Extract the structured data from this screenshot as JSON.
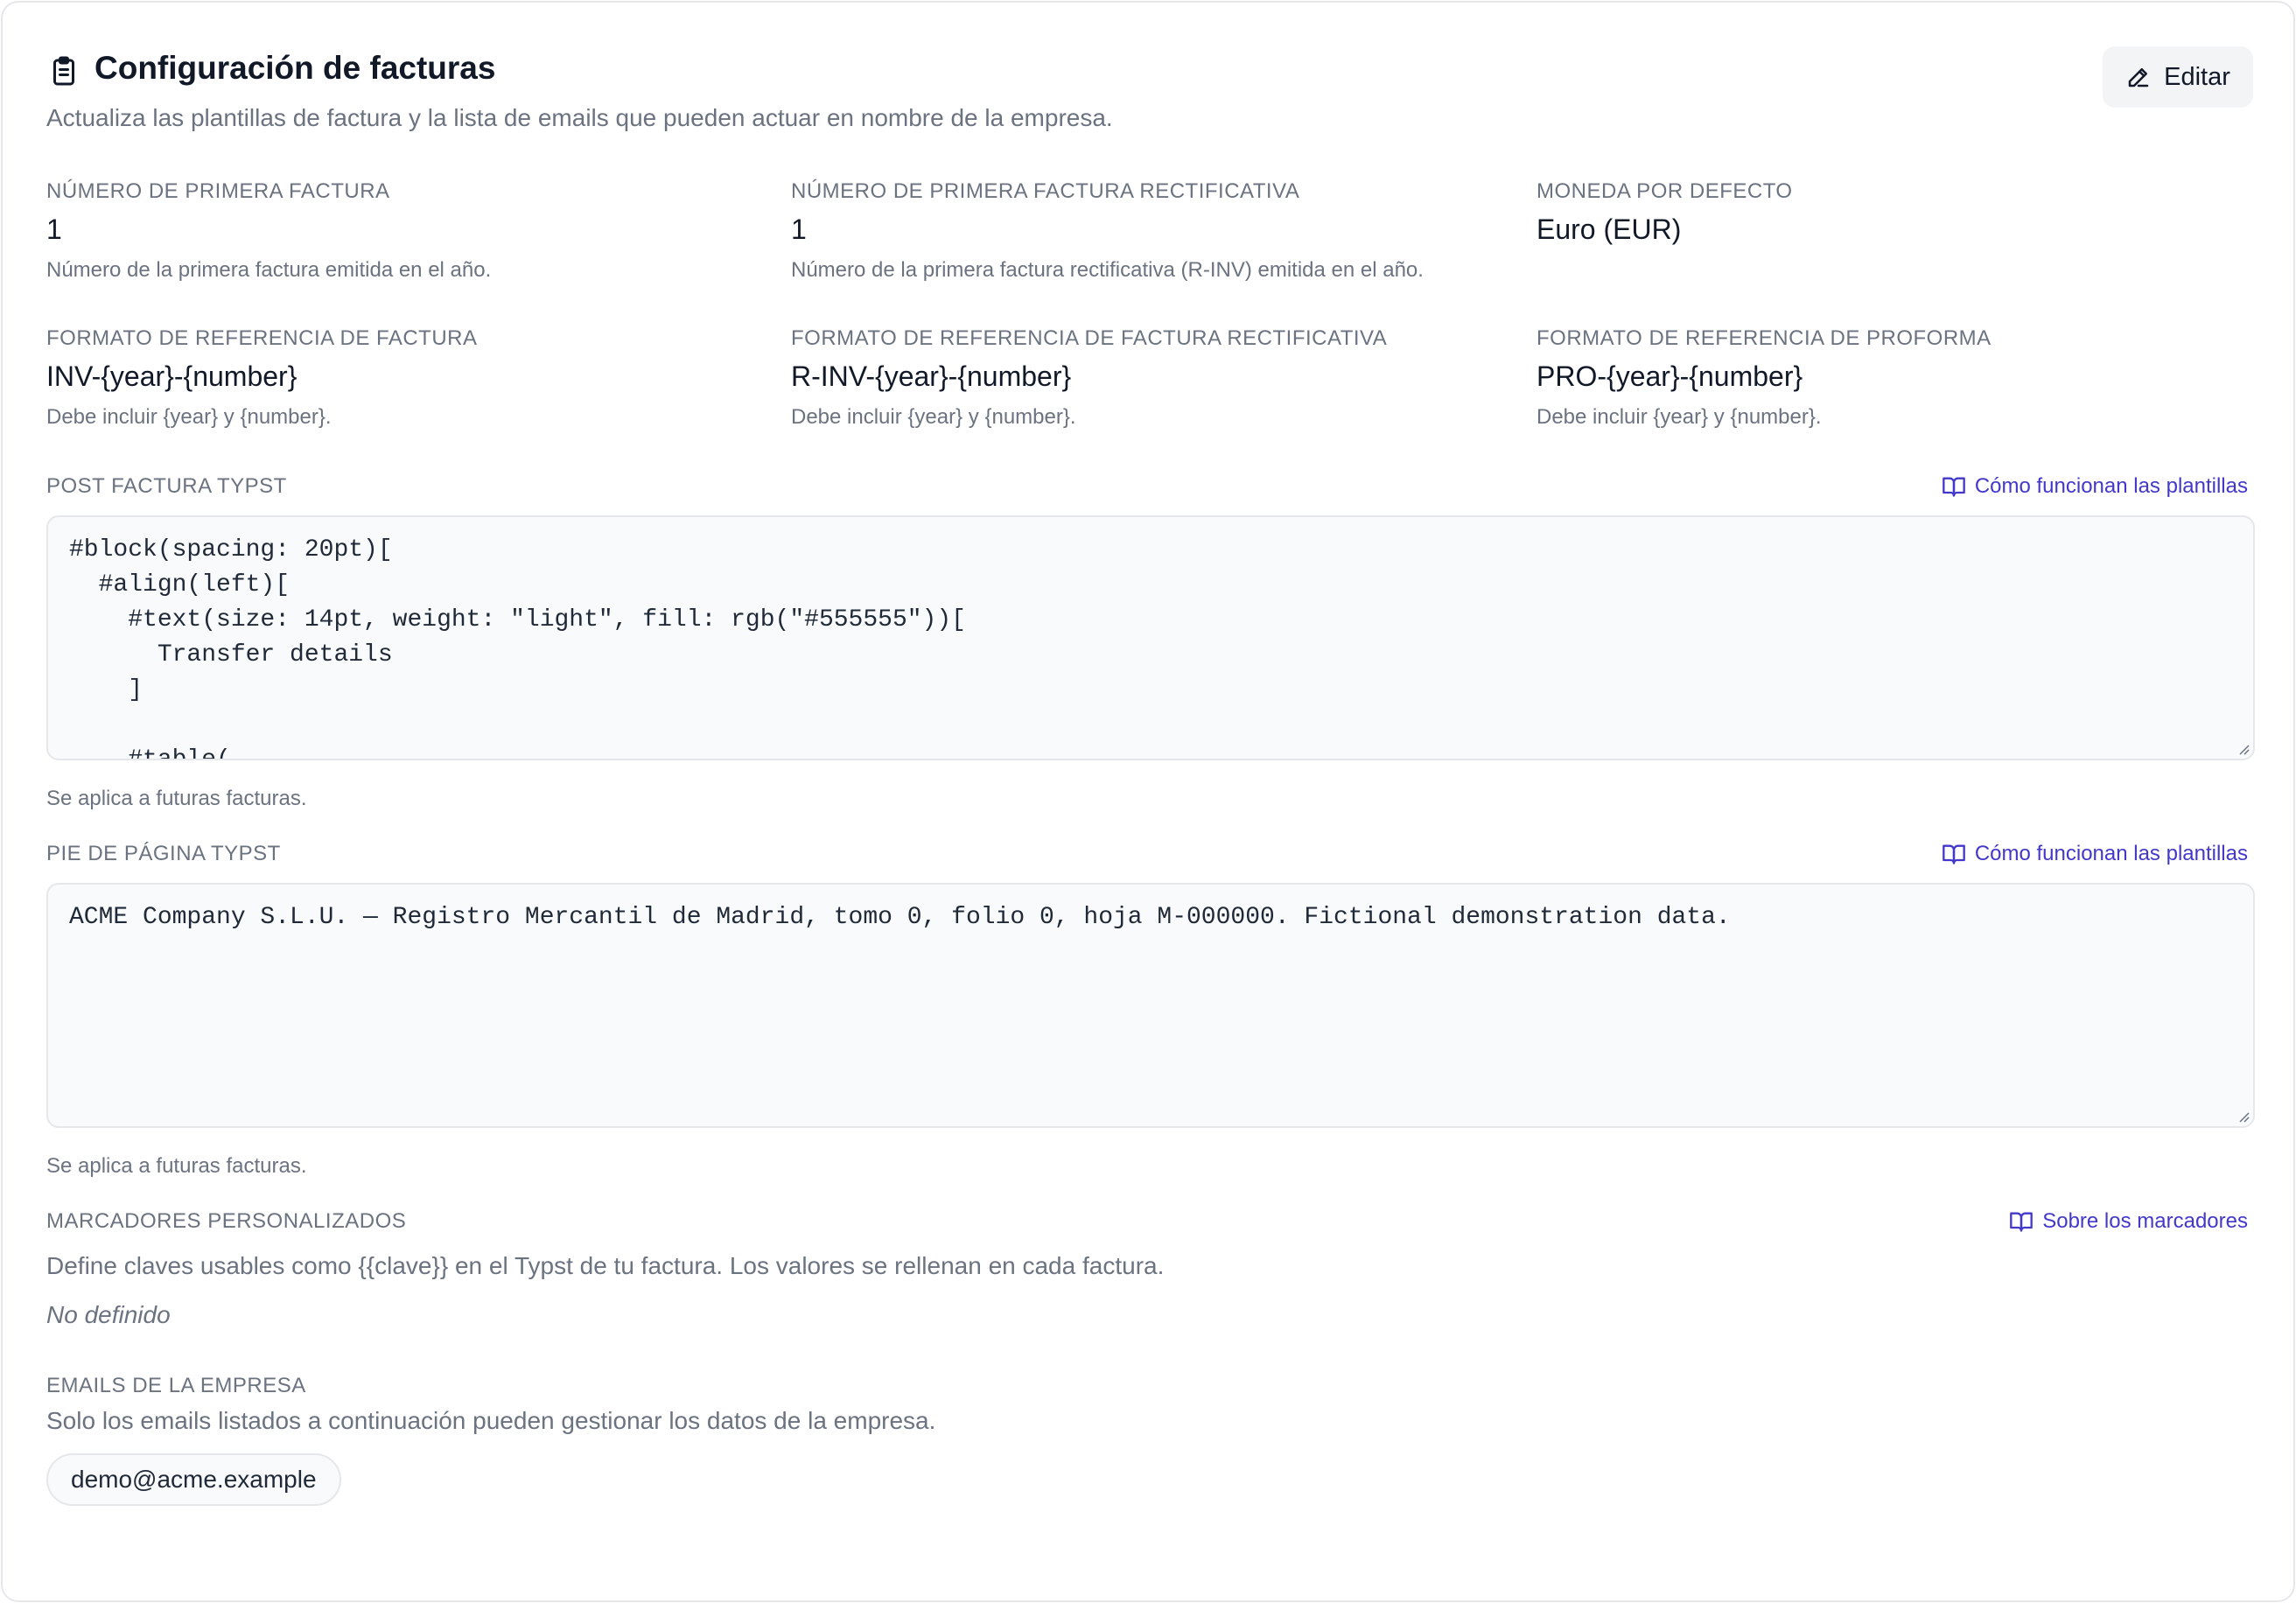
{
  "header": {
    "icon": "clipboard-icon",
    "title": "Configuración de facturas",
    "subtitle": "Actualiza las plantillas de factura y la lista de emails que pueden actuar en nombre de la empresa.",
    "edit_label": "Editar",
    "edit_icon": "pencil-icon"
  },
  "fields": {
    "first_invoice": {
      "label": "Número de primera factura",
      "value": "1",
      "hint": "Número de la primera factura emitida en el año."
    },
    "first_corrective": {
      "label": "Número de primera factura rectificativa",
      "value": "1",
      "hint": "Número de la primera factura rectificativa (R-INV) emitida en el año."
    },
    "currency": {
      "label": "Moneda por defecto",
      "value": "Euro (EUR)"
    },
    "invoice_format": {
      "label": "Formato de referencia de factura",
      "value": "INV-{year}-{number}",
      "hint": "Debe incluir {year} y {number}."
    },
    "corrective_format": {
      "label": "Formato de referencia de factura rectificativa",
      "value": "R-INV-{year}-{number}",
      "hint": "Debe incluir {year} y {number}."
    },
    "proforma_format": {
      "label": "Formato de referencia de proforma",
      "value": "PRO-{year}-{number}",
      "hint": "Debe incluir {year} y {number}."
    }
  },
  "post_invoice": {
    "label": "Post factura Typst",
    "link_label": "Cómo funcionan las plantillas",
    "code": "#block(spacing: 20pt)[\n  #align(left)[\n    #text(size: 14pt, weight: \"light\", fill: rgb(\"#555555\"))[\n      Transfer details\n    ]\n\n    #table(",
    "hint": "Se aplica a futuras facturas."
  },
  "footer_typst": {
    "label": "Pie de página Typst",
    "link_label": "Cómo funcionan las plantillas",
    "code": "ACME Company S.L.U. — Registro Mercantil de Madrid, tomo 0, folio 0, hoja M-000000. Fictional demonstration data.",
    "hint": "Se aplica a futuras facturas."
  },
  "placeholders": {
    "label": "Marcadores personalizados",
    "link_label": "Sobre los marcadores",
    "description": "Define claves usables como {{clave}} en el Typst de tu factura. Los valores se rellenan en cada factura.",
    "empty": "No definido"
  },
  "emails": {
    "label": "Emails de la empresa",
    "description": "Solo los emails listados a continuación pueden gestionar los datos de la empresa.",
    "items": [
      "demo@acme.example"
    ]
  },
  "colors": {
    "link": "#4338ca",
    "muted": "#6b7280",
    "text": "#111827"
  }
}
